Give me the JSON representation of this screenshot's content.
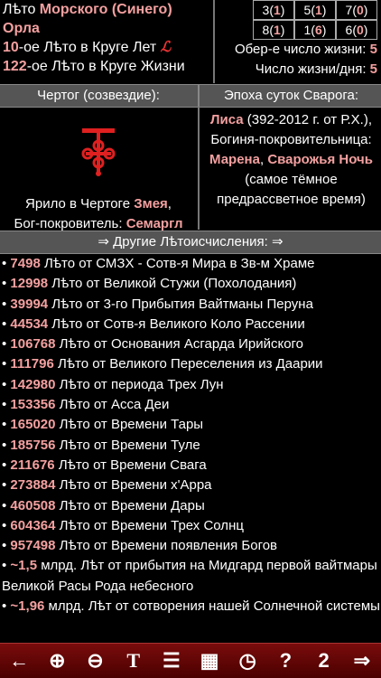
{
  "top": {
    "line1_a": "Лѣто ",
    "line1_b": "Морского (Синего)",
    "line2": "Орла",
    "circle_years_num": "10",
    "circle_years_text": "-ое Лѣто в Круге Лет ",
    "rune": "ℒ",
    "life_circle_num": "122",
    "life_circle_text": "-ое Лѣто в Круге Жизни"
  },
  "grid": [
    {
      "pre": "3(",
      "v": "1",
      "post": ")"
    },
    {
      "pre": "5(",
      "v": "1",
      "post": ")"
    },
    {
      "pre": "7(",
      "v": "0",
      "post": ")"
    },
    {
      "pre": "8(",
      "v": "1",
      "post": ")"
    },
    {
      "pre": "1(",
      "v": "6",
      "post": ")"
    },
    {
      "pre": "6(",
      "v": "0",
      "post": ")"
    }
  ],
  "numbers": {
    "ober_label": "Обер-е число жизни: ",
    "ober_val": "5",
    "life_label": "Число жизни/дня: ",
    "life_val": "5"
  },
  "headers": {
    "chertog": "Чертог (созвездие):",
    "epoch": "Эпоха суток Сварога:"
  },
  "chertog": {
    "t1": "Ярило в Чертоге ",
    "sign": "Змея",
    "t2": ",",
    "t3": "Бог-покровитель: ",
    "god": "Семаргл"
  },
  "epoch": {
    "name": "Лиса",
    "years": " (392-2012 г. от Р.Х.), Богиня-покровительница:",
    "goddess": "Марена",
    "sep": ", ",
    "night": "Сварожья Ночь",
    "rest": " (самое тёмное предрассветное время)"
  },
  "section_title": "⇒ Другие Лѣтоисчисления: ⇒",
  "list": [
    {
      "n": "7498",
      "t": " Лѣто от СМЗХ - Сотв-я Мира в Зв-м Храме"
    },
    {
      "n": "12998",
      "t": " Лѣто от Великой Стужи (Похолодания)"
    },
    {
      "n": "39994",
      "t": " Лѣто от 3-го Прибытия Вайтманы Перуна"
    },
    {
      "n": "44534",
      "t": " Лѣто от Сотв-я Великого Коло Рассении"
    },
    {
      "n": "106768",
      "t": " Лѣто от Основания Асгарда Ирийского"
    },
    {
      "n": "111796",
      "t": " Лѣто от Великого Переселения из Даарии"
    },
    {
      "n": "142980",
      "t": " Лѣто от периода Трех Лун"
    },
    {
      "n": "153356",
      "t": " Лѣто от Асса Деи"
    },
    {
      "n": "165020",
      "t": " Лѣто от Времени Тары"
    },
    {
      "n": "185756",
      "t": " Лѣто от Времени Туле"
    },
    {
      "n": "211676",
      "t": " Лѣто от Времени Свага"
    },
    {
      "n": "273884",
      "t": " Лѣто от Времени х'Арра"
    },
    {
      "n": "460508",
      "t": " Лѣто от Времени Дары"
    },
    {
      "n": "604364",
      "t": " Лѣто от Времени Трех Солнц"
    },
    {
      "n": "957498",
      "t": " Лѣто от Времени появления Богов"
    },
    {
      "n": "~1,5",
      "t": " млрд. Лѣт от прибытия на Мидгард первой вайтмары Великой Расы Рода небесного"
    },
    {
      "n": "~1,96",
      "t": " млрд. Лѣт от сотворения нашей Солнечной системы"
    }
  ],
  "toolbar": [
    "←",
    "⊕",
    "⊖",
    "T",
    "☰",
    "▦",
    "◷",
    "?",
    "2",
    "⇒"
  ],
  "colors": {
    "accent": "#f4a0a0",
    "toolbar": "#7a0c0c",
    "header": "#555555"
  }
}
